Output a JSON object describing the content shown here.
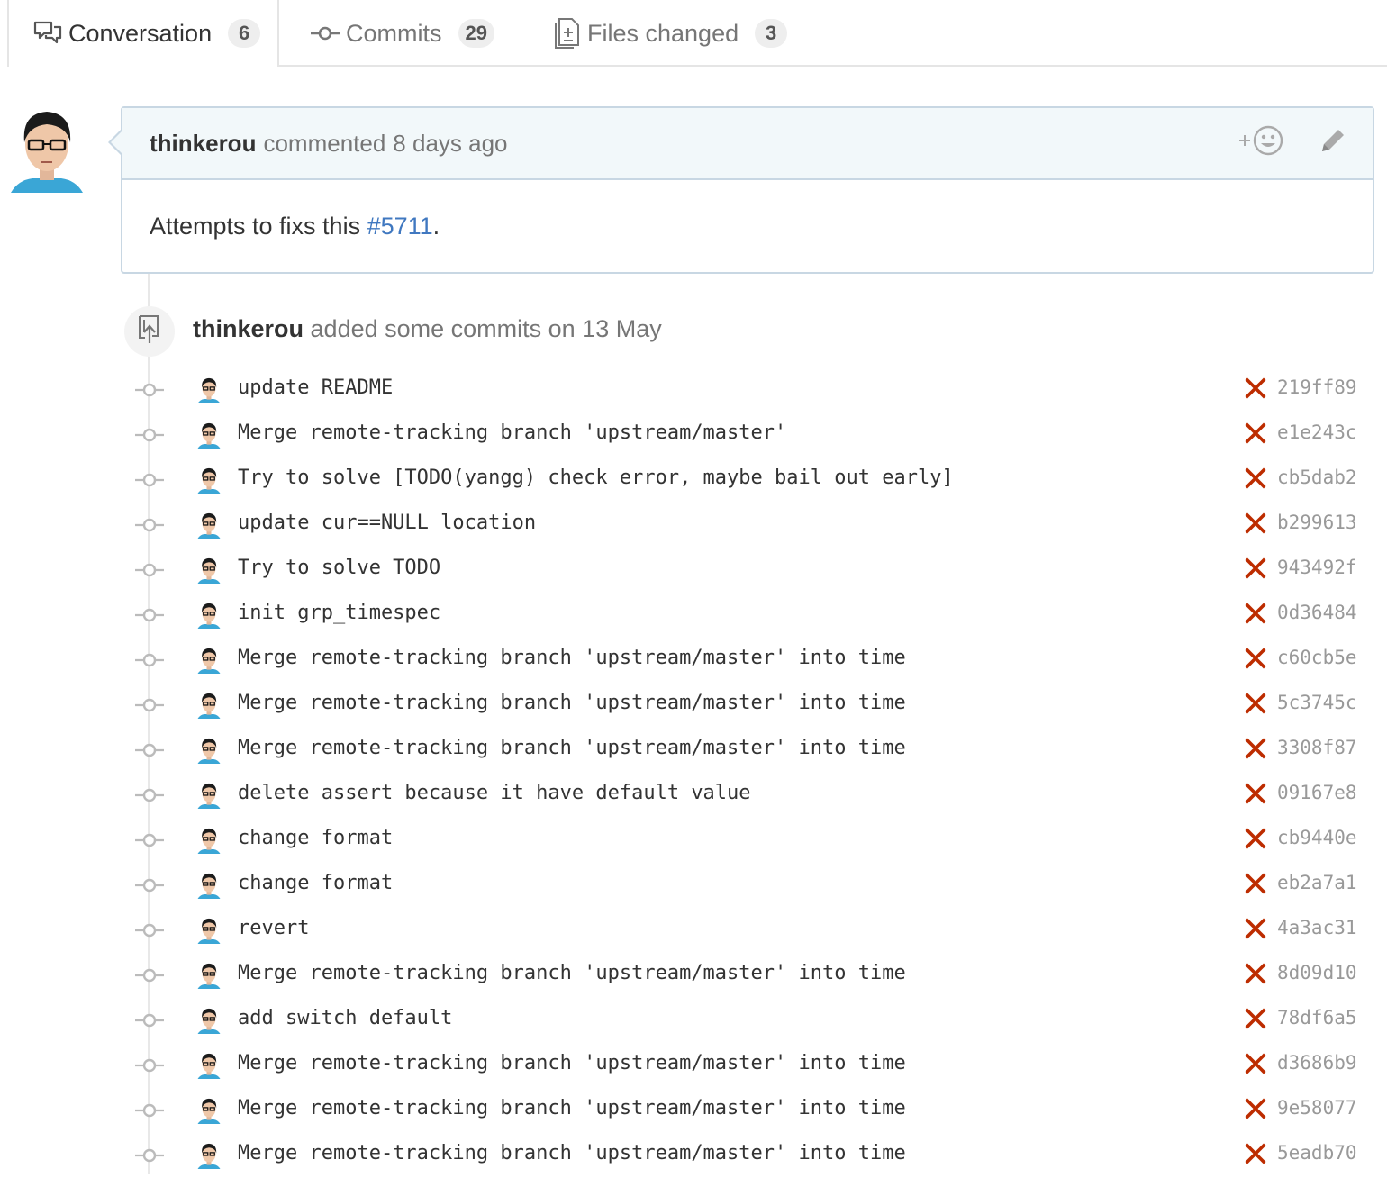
{
  "tabs": [
    {
      "label": "Conversation",
      "count": "6",
      "icon": "conversation-icon",
      "selected": true
    },
    {
      "label": "Commits",
      "count": "29",
      "icon": "commit-icon",
      "selected": false
    },
    {
      "label": "Files changed",
      "count": "3",
      "icon": "file-diff-icon",
      "selected": false
    }
  ],
  "comment": {
    "author": "thinkerou",
    "action": "commented",
    "time": "8 days ago",
    "body_text": "Attempts to fixs this ",
    "issue_link": "#5711",
    "body_suffix": "."
  },
  "push": {
    "author": "thinkerou",
    "text": "added some commits on 13 May"
  },
  "colors": {
    "link": "#4078c0",
    "status_failure": "#bd2c00",
    "sha": "#999999",
    "header_bg": "#f2f8fa",
    "border": "#c8d7e3"
  },
  "commits": [
    {
      "message": "update README",
      "sha": "219ff89",
      "status": "failure"
    },
    {
      "message": "Merge remote-tracking branch 'upstream/master'",
      "sha": "e1e243c",
      "status": "failure"
    },
    {
      "message": "Try to solve [TODO(yangg) check error, maybe bail out early]",
      "sha": "cb5dab2",
      "status": "failure"
    },
    {
      "message": "update cur==NULL location",
      "sha": "b299613",
      "status": "failure"
    },
    {
      "message": "Try to solve TODO",
      "sha": "943492f",
      "status": "failure"
    },
    {
      "message": "init grp_timespec",
      "sha": "0d36484",
      "status": "failure"
    },
    {
      "message": "Merge remote-tracking branch 'upstream/master' into time",
      "sha": "c60cb5e",
      "status": "failure"
    },
    {
      "message": "Merge remote-tracking branch 'upstream/master' into time",
      "sha": "5c3745c",
      "status": "failure"
    },
    {
      "message": "Merge remote-tracking branch 'upstream/master' into time",
      "sha": "3308f87",
      "status": "failure"
    },
    {
      "message": "delete assert because it have default value",
      "sha": "09167e8",
      "status": "failure"
    },
    {
      "message": "change format",
      "sha": "cb9440e",
      "status": "failure"
    },
    {
      "message": "change format",
      "sha": "eb2a7a1",
      "status": "failure"
    },
    {
      "message": "revert",
      "sha": "4a3ac31",
      "status": "failure"
    },
    {
      "message": "Merge remote-tracking branch 'upstream/master' into time",
      "sha": "8d09d10",
      "status": "failure"
    },
    {
      "message": "add switch default",
      "sha": "78df6a5",
      "status": "failure"
    },
    {
      "message": "Merge remote-tracking branch 'upstream/master' into time",
      "sha": "d3686b9",
      "status": "failure"
    },
    {
      "message": "Merge remote-tracking branch 'upstream/master' into time",
      "sha": "9e58077",
      "status": "failure"
    },
    {
      "message": "Merge remote-tracking branch 'upstream/master' into time",
      "sha": "5eadb70",
      "status": "failure"
    }
  ]
}
